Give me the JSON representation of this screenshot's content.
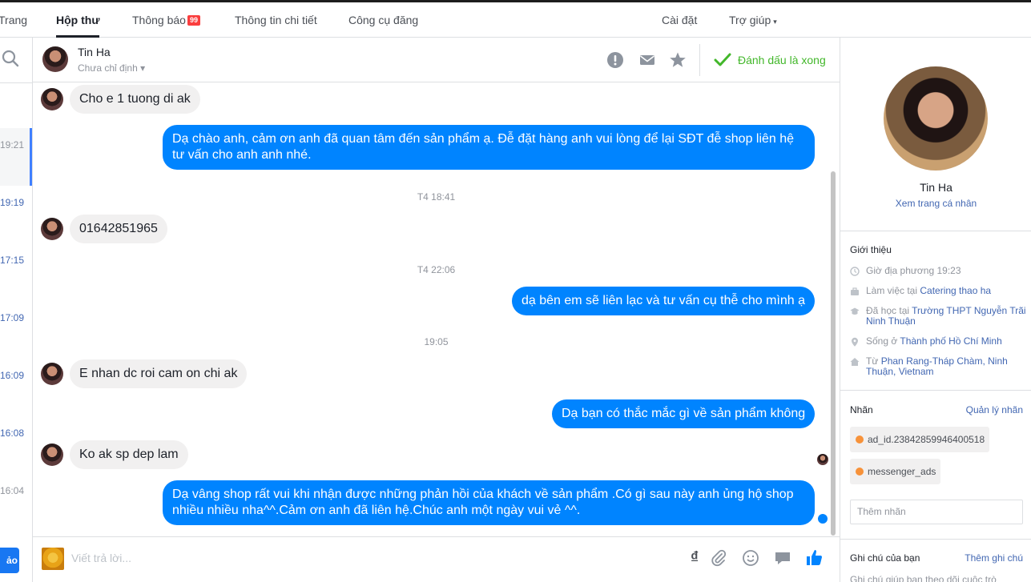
{
  "topbar": {
    "tabs": [
      {
        "label": "Trang"
      },
      {
        "label": "Hộp thư"
      },
      {
        "label": "Thông báo",
        "badge": "99"
      },
      {
        "label": "Thông tin chi tiết"
      },
      {
        "label": "Công cụ đăng"
      }
    ],
    "settings": "Cài đặt",
    "help": "Trợ giúp",
    "help_caret": "▾"
  },
  "inbox_list": {
    "times": [
      "19:21",
      "19:19",
      "17:15",
      "17:09",
      "16:09",
      "16:08",
      "16:04"
    ],
    "partial_button": "ảo"
  },
  "conversation": {
    "name": "Tin Ha",
    "assignment": "Chưa chỉ định",
    "assignment_caret": "▾",
    "mark_done": "Đánh dấu là xong",
    "icons": [
      "alert-icon",
      "envelope-icon",
      "star-icon",
      "checkmark-icon"
    ]
  },
  "thread": {
    "messages": [
      {
        "dir": "in",
        "text": "Cho e 1 tuong di ak"
      },
      {
        "dir": "out",
        "text": "Dạ chào anh, cảm ơn anh đã quan tâm đến sản phẩm ạ. Đễ đặt hàng anh vui lòng để lại SĐT đễ shop liên hệ tư vấn cho anh anh nhé."
      },
      {
        "dir": "stamp",
        "text": "T4 18:41"
      },
      {
        "dir": "in",
        "text": "01642851965"
      },
      {
        "dir": "stamp",
        "text": "T4 22:06"
      },
      {
        "dir": "out",
        "text": "dạ bên em sẽ liên lạc và tư vấn cụ thễ cho mình ạ"
      },
      {
        "dir": "stamp",
        "text": "19:05"
      },
      {
        "dir": "in",
        "text": "E nhan dc roi cam on chi ak"
      },
      {
        "dir": "out",
        "text": "Dạ bạn có thắc mắc gì về sản phẩm không"
      },
      {
        "dir": "in",
        "text": "Ko ak sp dep lam"
      },
      {
        "dir": "out",
        "text": "Dạ vâng shop rất vui khi nhận được những phản hồi của khách về sản phẩm .Có gì sau này anh ủng hộ shop nhiều nhiều nha^^.Cảm ơn anh đã liên hệ.Chúc anh một ngày vui vẻ ^^."
      }
    ]
  },
  "composer": {
    "placeholder": "Viết trả lời...",
    "currency_glyph": "₫",
    "icons": [
      "currency-icon",
      "attachment-icon",
      "emoji-icon",
      "sticker-icon",
      "like-icon"
    ]
  },
  "profile": {
    "name": "Tin Ha",
    "view_profile": "Xem trang cá nhân",
    "about_title": "Giới thiệu",
    "local_time": "Giờ địa phương 19:23",
    "work_prefix": "Làm việc tại ",
    "work_place": "Catering thao ha",
    "study_prefix": "Đã học tại ",
    "study_place": "Trường THPT Nguyễn Trãi Ninh Thuận",
    "lives_prefix": "Sống ở ",
    "lives_place": "Thành phố Hồ Chí Minh",
    "from_prefix": "Từ ",
    "from_place": "Phan Rang-Tháp Chàm, Ninh Thuận, Vietnam",
    "labels_title": "Nhãn",
    "manage_labels": "Quản lý nhãn",
    "labels": [
      "ad_id.23842859946400518",
      "messenger_ads"
    ],
    "label_dot_color": "#f7923a",
    "add_label_placeholder": "Thêm nhãn",
    "notes_title": "Ghi chú của bạn",
    "add_note": "Thêm ghi chú",
    "notes_hint": "Ghi chú giúp bạn theo dõi cuộc trò"
  },
  "colors": {
    "outgoing_bubble": "#0084ff",
    "incoming_bubble": "#f1f0f0",
    "link": "#4267b2",
    "done_green": "#42b72a"
  }
}
